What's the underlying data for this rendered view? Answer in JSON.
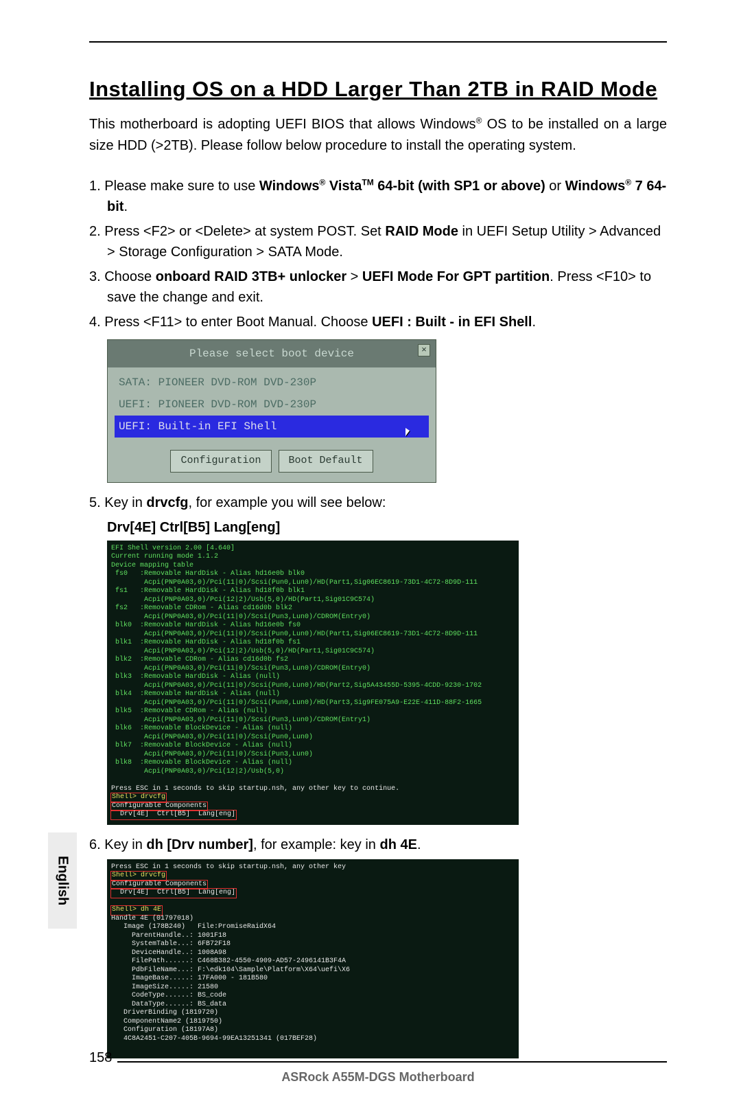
{
  "page": {
    "title": "Installing OS on a HDD Larger Than 2TB in RAID Mode",
    "intro_a": "This motherboard is adopting UEFI BIOS that allows Windows",
    "intro_b": " OS to be installed on a large size HDD (>2TB). Please follow below procedure to install the operating system.",
    "page_number": "158",
    "footer": "ASRock  A55M-DGS  Motherboard",
    "side_label": "English"
  },
  "steps": {
    "s1_a": "1. Please make sure to use ",
    "s1_b": "Windows",
    "s1_c": " Vista",
    "s1_d": " 64-bit (with SP1 or above)",
    "s1_e": " or ",
    "s1_f": "Windows",
    "s1_g": " 7 64-bit",
    "s1_h": ".",
    "s2_a": "2. Press <F2> or <Delete> at system POST. Set ",
    "s2_b": "RAID Mode",
    "s2_c": " in UEFI Setup Utility > Advanced > Storage Configuration > SATA Mode.",
    "s3_a": "3. Choose ",
    "s3_b": "onboard RAID 3TB+ unlocker",
    "s3_c": " > ",
    "s3_d": "UEFI Mode For GPT partition",
    "s3_e": ". Press <F10> to save the change and exit.",
    "s4_a": "4. Press <F11> to enter Boot Manual. Choose ",
    "s4_b": "UEFI : Built - in EFI Shell",
    "s4_c": ".",
    "s5_a": "5. Key in ",
    "s5_b": "drvcfg",
    "s5_c": ", for example you will see below:",
    "s5_line": "Drv[4E]   Ctrl[B5]   Lang[eng]",
    "s6_a": "6. Key in ",
    "s6_b": "dh [Drv number]",
    "s6_c": ", for example: key in ",
    "s6_d": "dh 4E",
    "s6_e": "."
  },
  "boot": {
    "header": "Please select boot device",
    "close": "×",
    "item1": "SATA: PIONEER DVD-ROM DVD-230P",
    "item2": "UEFI: PIONEER DVD-ROM DVD-230P",
    "item3": "UEFI: Built-in EFI Shell",
    "btn1": "Configuration",
    "btn2": "Boot Default"
  },
  "term1_lines": [
    "EFI Shell version 2.00 [4.640]",
    "Current running mode 1.1.2",
    "Device mapping table",
    " fs0   :Removable HardDisk - Alias hd16e0b blk0",
    "        Acpi(PNP0A03,0)/Pci(11|0)/Scsi(Pun0,Lun0)/HD(Part1,Sig06EC8619-73D1-4C72-8D9D-111",
    " fs1   :Removable HardDisk - Alias hd18f0b blk1",
    "        Acpi(PNP0A03,0)/Pci(12|2)/Usb(5,0)/HD(Part1,Sig01C9C574)",
    " fs2   :Removable CDRom - Alias cd16d0b blk2",
    "        Acpi(PNP0A03,0)/Pci(11|0)/Scsi(Pun3,Lun0)/CDROM(Entry0)",
    " blk0  :Removable HardDisk - Alias hd16e0b fs0",
    "        Acpi(PNP0A03,0)/Pci(11|0)/Scsi(Pun0,Lun0)/HD(Part1,Sig06EC8619-73D1-4C72-8D9D-111",
    " blk1  :Removable HardDisk - Alias hd18f0b fs1",
    "        Acpi(PNP0A03,0)/Pci(12|2)/Usb(5,0)/HD(Part1,Sig01C9C574)",
    " blk2  :Removable CDRom - Alias cd16d0b fs2",
    "        Acpi(PNP0A03,0)/Pci(11|0)/Scsi(Pun3,Lun0)/CDROM(Entry0)",
    " blk3  :Removable HardDisk - Alias (null)",
    "        Acpi(PNP0A03,0)/Pci(11|0)/Scsi(Pun0,Lun0)/HD(Part2,Sig5A43455D-5395-4CDD-9230-1702",
    " blk4  :Removable HardDisk - Alias (null)",
    "        Acpi(PNP0A03,0)/Pci(11|0)/Scsi(Pun0,Lun0)/HD(Part3,Sig9FE075A9-E22E-411D-88F2-1665",
    " blk5  :Removable CDRom - Alias (null)",
    "        Acpi(PNP0A03,0)/Pci(11|0)/Scsi(Pun3,Lun0)/CDROM(Entry1)",
    " blk6  :Removable BlockDevice - Alias (null)",
    "        Acpi(PNP0A03,0)/Pci(11|0)/Scsi(Pun0,Lun0)",
    " blk7  :Removable BlockDevice - Alias (null)",
    "        Acpi(PNP0A03,0)/Pci(11|0)/Scsi(Pun3,Lun0)",
    " blk8  :Removable BlockDevice - Alias (null)",
    "        Acpi(PNP0A03,0)/Pci(12|2)/Usb(5,0)",
    "",
    "Press ESC in 1 seconds to skip startup.nsh, any other key to continue.",
    "Shell> drvcfg",
    "Configurable Components",
    "  Drv[4E]  Ctrl[B5]  Lang[eng]"
  ],
  "term2_lines": [
    "Press ESC in 1 seconds to skip startup.nsh, any other key",
    "Shell> drvcfg",
    "Configurable Components",
    "  Drv[4E]  Ctrl[B5]  Lang[eng]",
    "",
    "Shell> dh 4E",
    "Handle 4E (01797018)",
    "   Image (178B240)   File:PromiseRaidX64",
    "     ParentHandle..: 1001F18",
    "     SystemTable...: 6FB72F18",
    "     DeviceHandle..: 1008A98",
    "     FilePath......: C468B382-4550-4909-AD57-2496141B3F4A",
    "     PdbFileName...: F:\\edk104\\Sample\\Platform\\X64\\uefi\\X6",
    "     ImageBase.....: 17FA000 - 181B580",
    "     ImageSize.....: 21580",
    "     CodeType......: BS_code",
    "     DataType......: BS_data",
    "   DriverBinding (1819720)",
    "   ComponentName2 (1819750)",
    "   Configuration (18197A8)",
    "   4C8A2451-C207-405B-9694-99EA13251341 (017BEF28)"
  ]
}
